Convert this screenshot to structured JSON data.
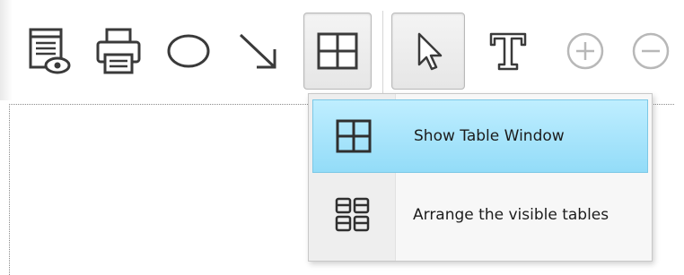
{
  "toolbar": {
    "buttons": [
      {
        "name": "print-preview",
        "icon": "print-preview-icon"
      },
      {
        "name": "print",
        "icon": "printer-icon"
      },
      {
        "name": "ellipse-tool",
        "icon": "ellipse-icon"
      },
      {
        "name": "arrow-tool",
        "icon": "diagonal-arrow-icon"
      },
      {
        "name": "table-tool",
        "icon": "table-grid-icon",
        "pressed": true
      },
      {
        "name": "select-tool",
        "icon": "cursor-arrow-icon",
        "pressed": true
      },
      {
        "name": "text-tool",
        "icon": "text-t-icon"
      },
      {
        "name": "zoom-in",
        "icon": "zoom-in-icon"
      },
      {
        "name": "zoom-out",
        "icon": "zoom-out-icon"
      }
    ]
  },
  "popup_menu": {
    "items": [
      {
        "label": "Show Table Window",
        "icon": "table-grid-icon",
        "highlighted": true
      },
      {
        "label": "Arrange the visible tables",
        "icon": "arrange-tables-icon",
        "highlighted": false
      }
    ]
  },
  "colors": {
    "menu_highlight": "#9fe0fa",
    "icon_stroke": "#3a3a3a",
    "disabled_icon": "#b8b8b8"
  }
}
